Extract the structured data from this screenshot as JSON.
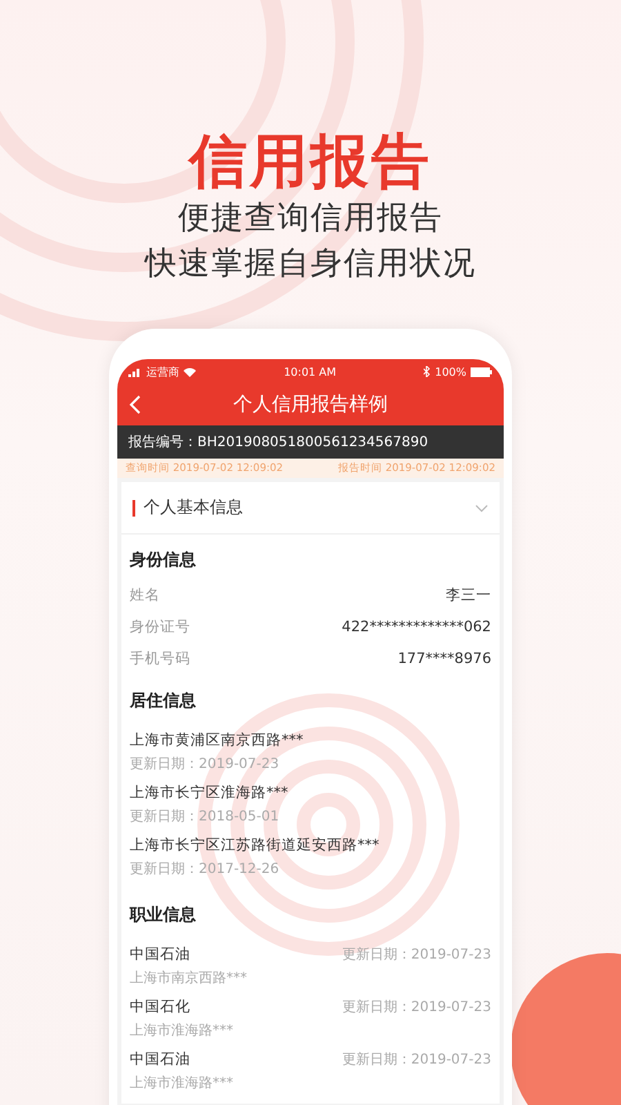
{
  "promo": {
    "title": "信用报告",
    "subtitles": [
      "便捷查询信用报告",
      "快速掌握自身信用状况"
    ]
  },
  "status_bar": {
    "carrier": "运营商",
    "time": "10:01 AM",
    "battery": "100%"
  },
  "nav": {
    "title": "个人信用报告样例"
  },
  "report": {
    "number": "报告编号：BH201908051800561234567890",
    "times": [
      "查询时间  2019-07-02 12:09:02",
      "报告时间  2019-07-02 12:09:02"
    ]
  },
  "section": {
    "title": "个人基本信息"
  },
  "identity": {
    "heading": "身份信息",
    "fields": [
      {
        "label": "姓名",
        "value": "李三一"
      },
      {
        "label": "身份证号",
        "value": "422*************062"
      },
      {
        "label": "手机号码",
        "value": "177****8976"
      }
    ]
  },
  "residence": {
    "heading": "居住信息",
    "items": [
      {
        "address": "上海市黄浦区南京西路***",
        "date": "更新日期：2019-07-23"
      },
      {
        "address": "上海市长宁区淮海路***",
        "date": "更新日期：2018-05-01"
      },
      {
        "address": "上海市长宁区江苏路街道延安西路***",
        "date": "更新日期：2017-12-26"
      }
    ]
  },
  "occupation": {
    "heading": "职业信息",
    "items": [
      {
        "company": "中国石油",
        "address": "上海市南京西路***",
        "date": "更新日期：2019-07-23"
      },
      {
        "company": "中国石化",
        "address": "上海市淮海路***",
        "date": "更新日期：2019-07-23"
      },
      {
        "company": "中国石油",
        "address": "上海市淮海路***",
        "date": "更新日期：2019-07-23"
      }
    ]
  }
}
